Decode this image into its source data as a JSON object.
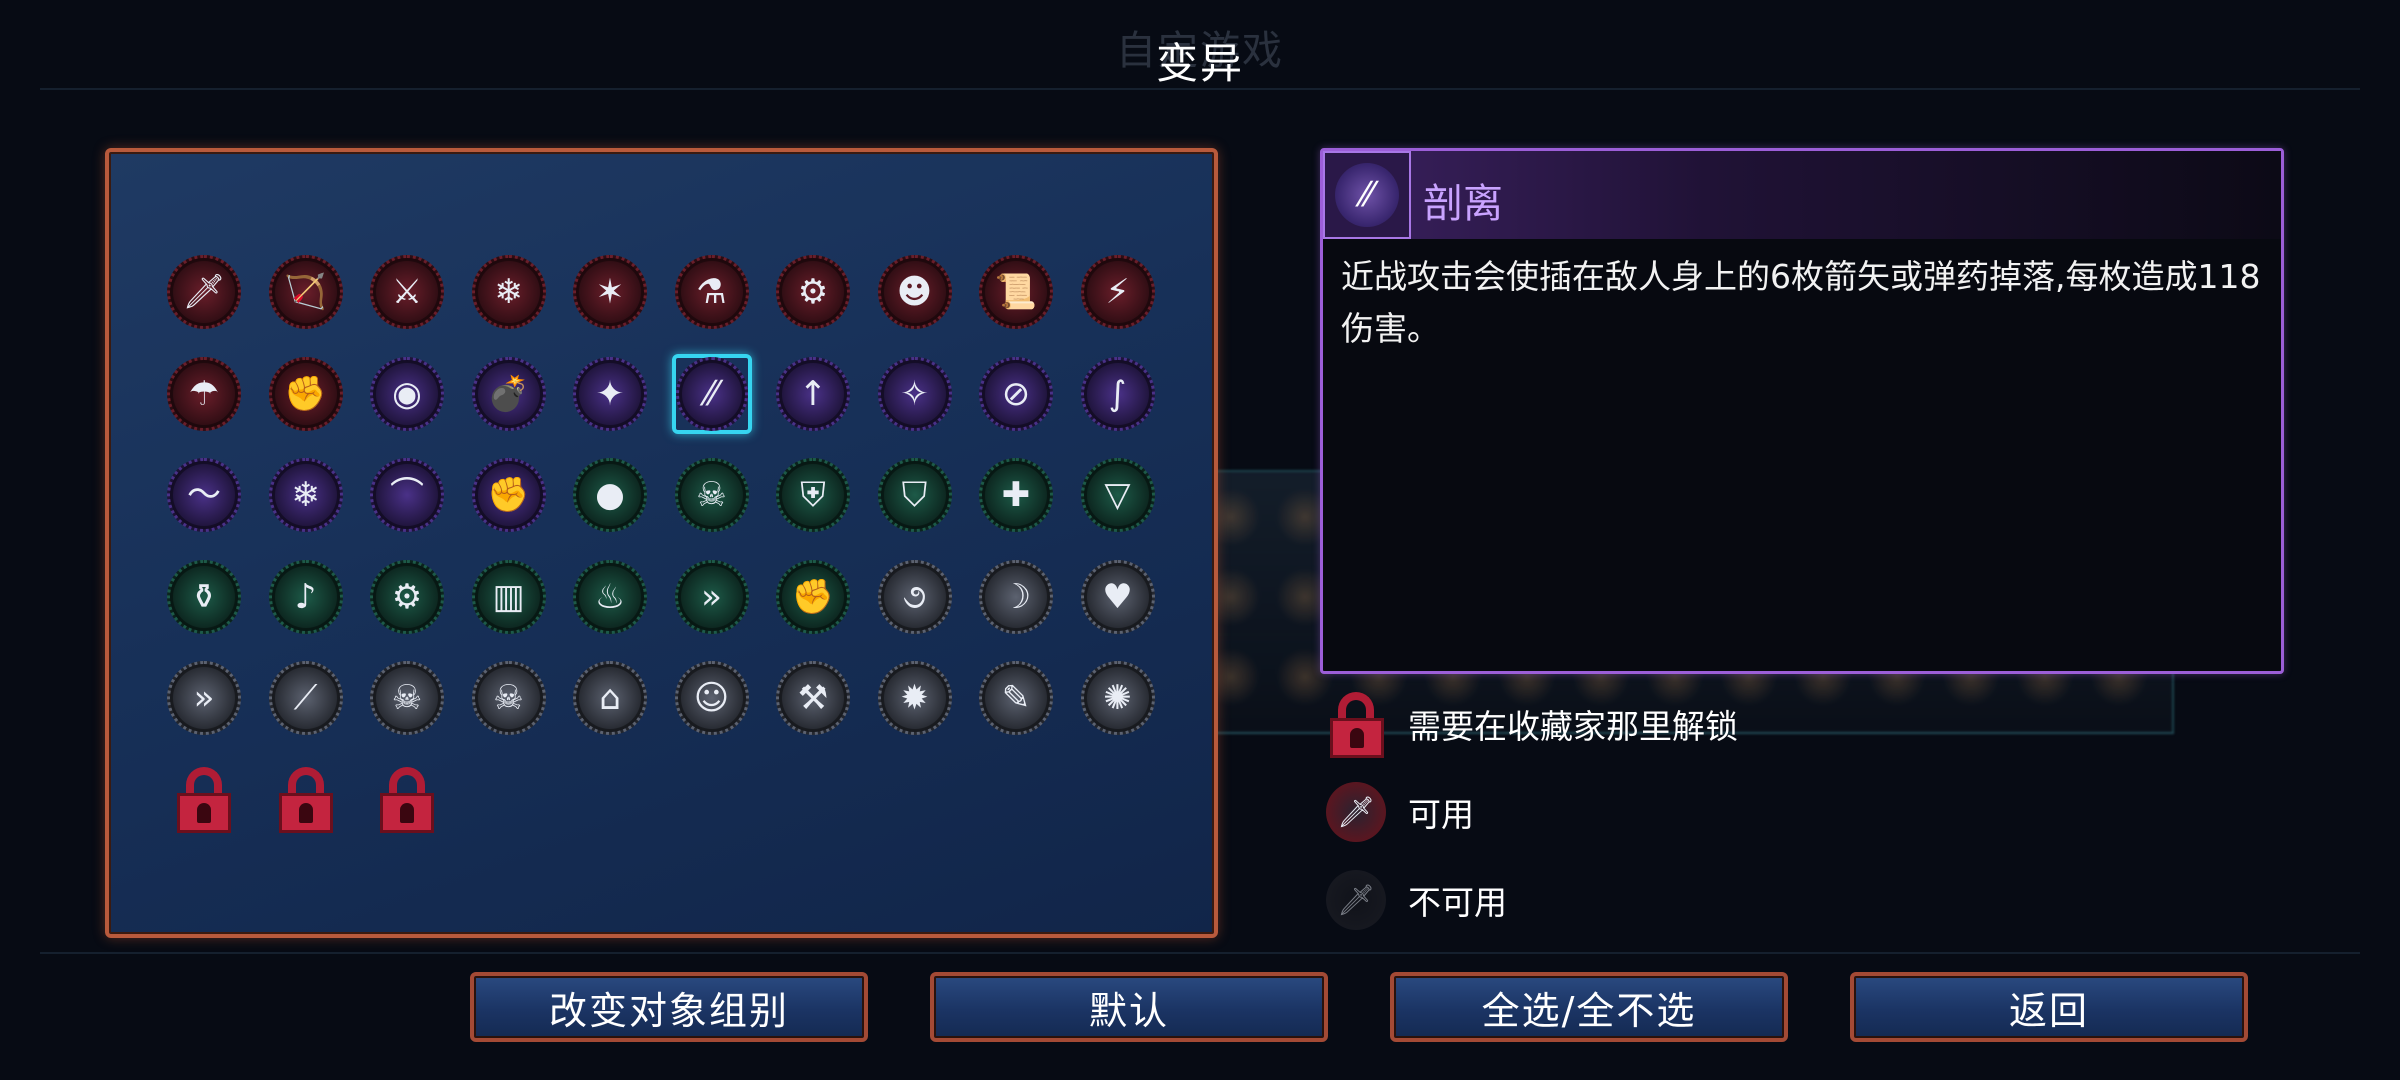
{
  "ghost_title": "自定游戏",
  "title": "变异",
  "colors": {
    "panel_border": "#b85a3c",
    "selected_border": "#36d5f0",
    "info_border": "#9c5ed8",
    "name_color": "#c9a3ff",
    "ring_red": "#7a1a22",
    "ring_purple": "#4b2f86",
    "ring_green": "#1f5f4a",
    "ring_gray": "#5a5f6a"
  },
  "mutations": [
    {
      "icon": "dagger-icon",
      "glyph": "🗡",
      "ring": "red"
    },
    {
      "icon": "crossbow-icon",
      "glyph": "🏹",
      "ring": "red"
    },
    {
      "icon": "red-dagger-icon",
      "glyph": "⚔",
      "ring": "red"
    },
    {
      "icon": "ice-scythe-icon",
      "glyph": "❄",
      "ring": "red"
    },
    {
      "icon": "red-claw-icon",
      "glyph": "✶",
      "ring": "red"
    },
    {
      "icon": "fire-flask-icon",
      "glyph": "⚗",
      "ring": "red"
    },
    {
      "icon": "turret-icon",
      "glyph": "⚙",
      "ring": "red"
    },
    {
      "icon": "red-face-icon",
      "glyph": "☻",
      "ring": "red"
    },
    {
      "icon": "blue-scroll-icon",
      "glyph": "📜",
      "ring": "red"
    },
    {
      "icon": "lightning-icon",
      "glyph": "⚡",
      "ring": "red"
    },
    {
      "icon": "umbrella-trap-icon",
      "glyph": "☂",
      "ring": "red"
    },
    {
      "icon": "fist-blade-icon",
      "glyph": "✊",
      "ring": "red"
    },
    {
      "icon": "eye-icon",
      "glyph": "◉",
      "ring": "purple"
    },
    {
      "icon": "bomb-icon",
      "glyph": "💣",
      "ring": "purple"
    },
    {
      "icon": "red-star-icon",
      "glyph": "✦",
      "ring": "purple"
    },
    {
      "icon": "detach-icon",
      "glyph": "⁄⁄",
      "ring": "purple",
      "selected": true
    },
    {
      "icon": "green-scroll-icon",
      "glyph": "↑",
      "ring": "purple"
    },
    {
      "icon": "shuriken-icon",
      "glyph": "✧",
      "ring": "purple"
    },
    {
      "icon": "no-arrow-icon",
      "glyph": "⊘",
      "ring": "purple"
    },
    {
      "icon": "white-snake-icon",
      "glyph": "∫",
      "ring": "purple"
    },
    {
      "icon": "blue-wave-icon",
      "glyph": "〜",
      "ring": "purple"
    },
    {
      "icon": "frost-gun-icon",
      "glyph": "❄",
      "ring": "purple"
    },
    {
      "icon": "bow-icon",
      "glyph": "⌒",
      "ring": "purple"
    },
    {
      "icon": "fist-bow-icon",
      "glyph": "✊",
      "ring": "purple"
    },
    {
      "icon": "purple-drop-icon",
      "glyph": "●",
      "ring": "green"
    },
    {
      "icon": "skull-swords-icon",
      "glyph": "☠",
      "ring": "green"
    },
    {
      "icon": "blue-shield-icon",
      "glyph": "⛨",
      "ring": "green"
    },
    {
      "icon": "gold-shield-icon",
      "glyph": "⛉",
      "ring": "green"
    },
    {
      "icon": "green-cross-shield-icon",
      "glyph": "✚",
      "ring": "green"
    },
    {
      "icon": "fangs-icon",
      "glyph": "▽",
      "ring": "green"
    },
    {
      "icon": "red-potion-icon",
      "glyph": "⚱",
      "ring": "green"
    },
    {
      "icon": "guitar-icon",
      "glyph": "♪",
      "ring": "green"
    },
    {
      "icon": "gear-eye-icon",
      "glyph": "⚙",
      "ring": "green"
    },
    {
      "icon": "blue-cage-icon",
      "glyph": "▥",
      "ring": "green"
    },
    {
      "icon": "flame-icon",
      "glyph": "♨",
      "ring": "green"
    },
    {
      "icon": "chevrons-icon",
      "glyph": "»",
      "ring": "green"
    },
    {
      "icon": "fist-shield-icon",
      "glyph": "✊",
      "ring": "green"
    },
    {
      "icon": "red-swirl-icon",
      "glyph": "૭",
      "ring": "gray"
    },
    {
      "icon": "gold-banana-icon",
      "glyph": "☽",
      "ring": "gray"
    },
    {
      "icon": "potion-heart-icon",
      "glyph": "♥",
      "ring": "gray"
    },
    {
      "icon": "gold-chevrons-icon",
      "glyph": "»",
      "ring": "gray"
    },
    {
      "icon": "green-blade-icon",
      "glyph": "⟋",
      "ring": "gray"
    },
    {
      "icon": "green-skull-icon",
      "glyph": "☠",
      "ring": "gray"
    },
    {
      "icon": "blue-skull-icon",
      "glyph": "☠",
      "ring": "gray"
    },
    {
      "icon": "blue-arch-icon",
      "glyph": "⌂",
      "ring": "gray"
    },
    {
      "icon": "purple-bubble-icon",
      "glyph": "☺",
      "ring": "gray"
    },
    {
      "icon": "axe-icon",
      "glyph": "⚒",
      "ring": "gray"
    },
    {
      "icon": "sun-burst-icon",
      "glyph": "✹",
      "ring": "gray"
    },
    {
      "icon": "bandaged-arm-icon",
      "glyph": "✎",
      "ring": "gray"
    },
    {
      "icon": "gold-sparkle-icon",
      "glyph": "✺",
      "ring": "gray"
    },
    {
      "icon": "lock-icon",
      "locked": true
    },
    {
      "icon": "lock-icon",
      "locked": true
    },
    {
      "icon": "lock-icon",
      "locked": true
    }
  ],
  "info": {
    "name": "剖离",
    "description": "近战攻击会使插在敌人身上的6枚箭矢或弹药掉落,每枚造成118伤害。",
    "icon": "detach-icon",
    "glyph": "⁄⁄"
  },
  "legend": [
    {
      "icon": "lock-icon",
      "text": "需要在收藏家那里解锁"
    },
    {
      "icon": "dagger-icon",
      "glyph": "🗡",
      "text": "可用"
    },
    {
      "icon": "dagger-dim-icon",
      "glyph": "🗡",
      "text": "不可用"
    }
  ],
  "buttons": [
    {
      "label": "改变对象组别"
    },
    {
      "label": "默认"
    },
    {
      "label": "全选/全不选"
    },
    {
      "label": "返回"
    }
  ]
}
